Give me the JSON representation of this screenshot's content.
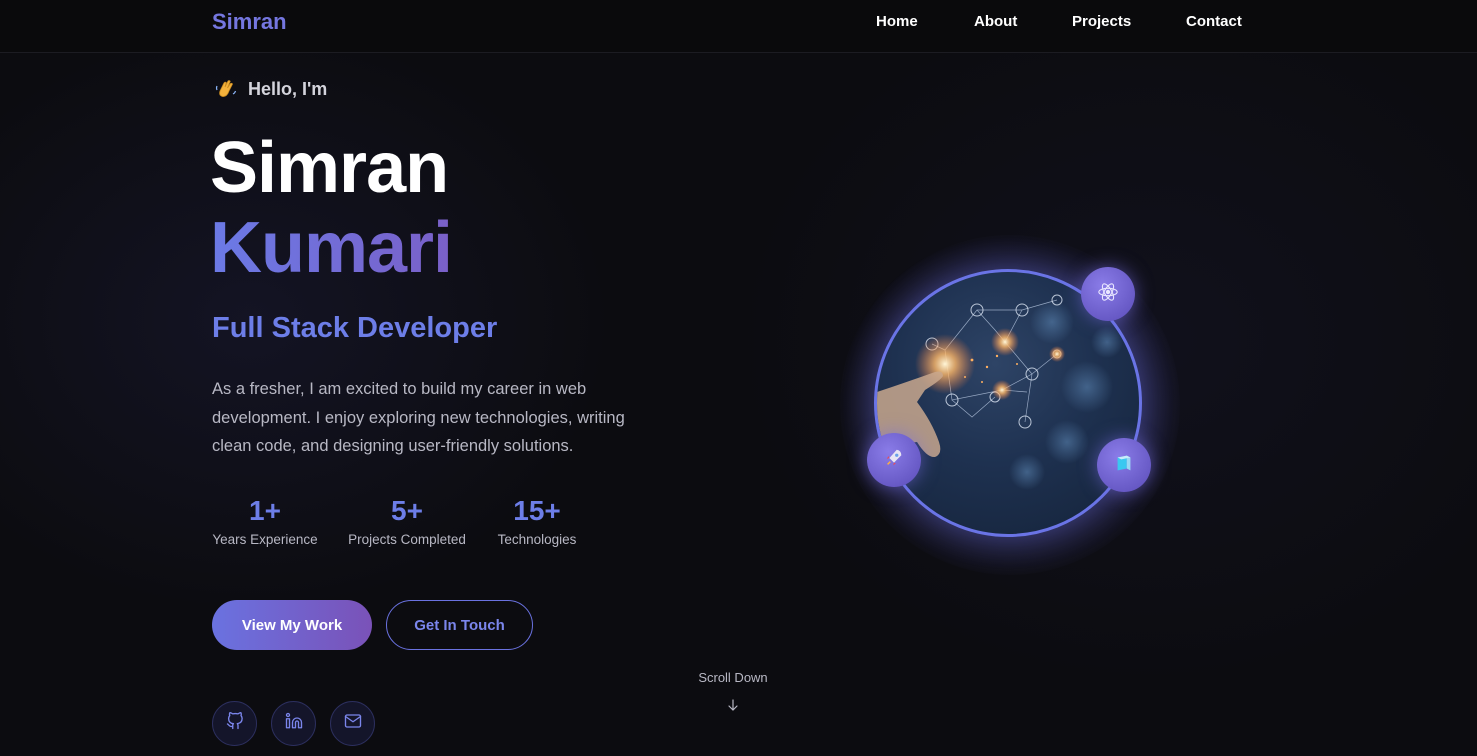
{
  "nav": {
    "brand": "Simran",
    "links": [
      "Home",
      "About",
      "Projects",
      "Contact"
    ]
  },
  "hero": {
    "greeting": "Hello, I'm",
    "greeting_icon": "waving-hand-icon",
    "first_name": "Simran",
    "last_name": "Kumari",
    "role": "Full Stack Developer",
    "description": "As a fresher, I am excited to build my career in web development. I enjoy exploring new technologies, writing clean code, and designing user-friendly solutions.",
    "stats": [
      {
        "value": "1+",
        "label": "Years Experience"
      },
      {
        "value": "5+",
        "label": "Projects Completed"
      },
      {
        "value": "15+",
        "label": "Technologies"
      }
    ],
    "primary_button": "View My Work",
    "secondary_button": "Get In Touch",
    "socials": [
      "github-icon",
      "linkedin-icon",
      "mail-icon"
    ],
    "scroll_text": "Scroll Down",
    "floating_icons": [
      "react-icon",
      "rocket-icon",
      "cube-icon"
    ]
  },
  "colors": {
    "accent": "#6d7ee8",
    "accent_purple": "#7a52b8",
    "background": "#0c0c10"
  }
}
